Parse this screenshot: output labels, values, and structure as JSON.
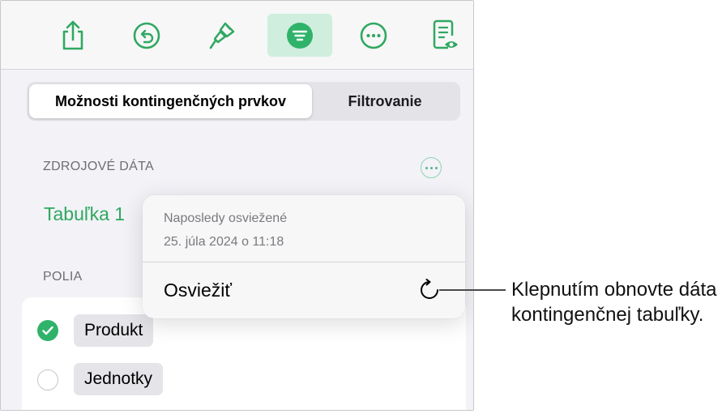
{
  "toolbar": {
    "items": [
      {
        "icon": "share-icon",
        "active": false
      },
      {
        "icon": "undo-icon",
        "active": false
      },
      {
        "icon": "format-brush-icon",
        "active": false
      },
      {
        "icon": "organize-icon",
        "active": true
      },
      {
        "icon": "more-icon",
        "active": false
      },
      {
        "icon": "document-view-icon",
        "active": false
      }
    ]
  },
  "tabs": {
    "options_label": "Možnosti kontingenčných prvkov",
    "filter_label": "Filtrovanie"
  },
  "source": {
    "section_title": "ZDROJOVÉ DÁTA",
    "table_name": "Tabuľka 1"
  },
  "fields": {
    "section_title": "POLIA",
    "items": [
      {
        "label": "Produkt",
        "checked": true
      },
      {
        "label": "Jednotky",
        "checked": false
      }
    ]
  },
  "popover": {
    "line1": "Naposledy osviežené",
    "line2": "25. júla 2024 o 11:18",
    "action_label": "Osviežiť",
    "action_icon": "refresh-icon"
  },
  "callout": {
    "text": "Klepnutím obnovte dáta kontingenčnej tabuľky."
  },
  "colors": {
    "accent": "#2fa85e",
    "active_tab_bg": "#cfeedd",
    "panel_bg": "#f2f2f7"
  }
}
